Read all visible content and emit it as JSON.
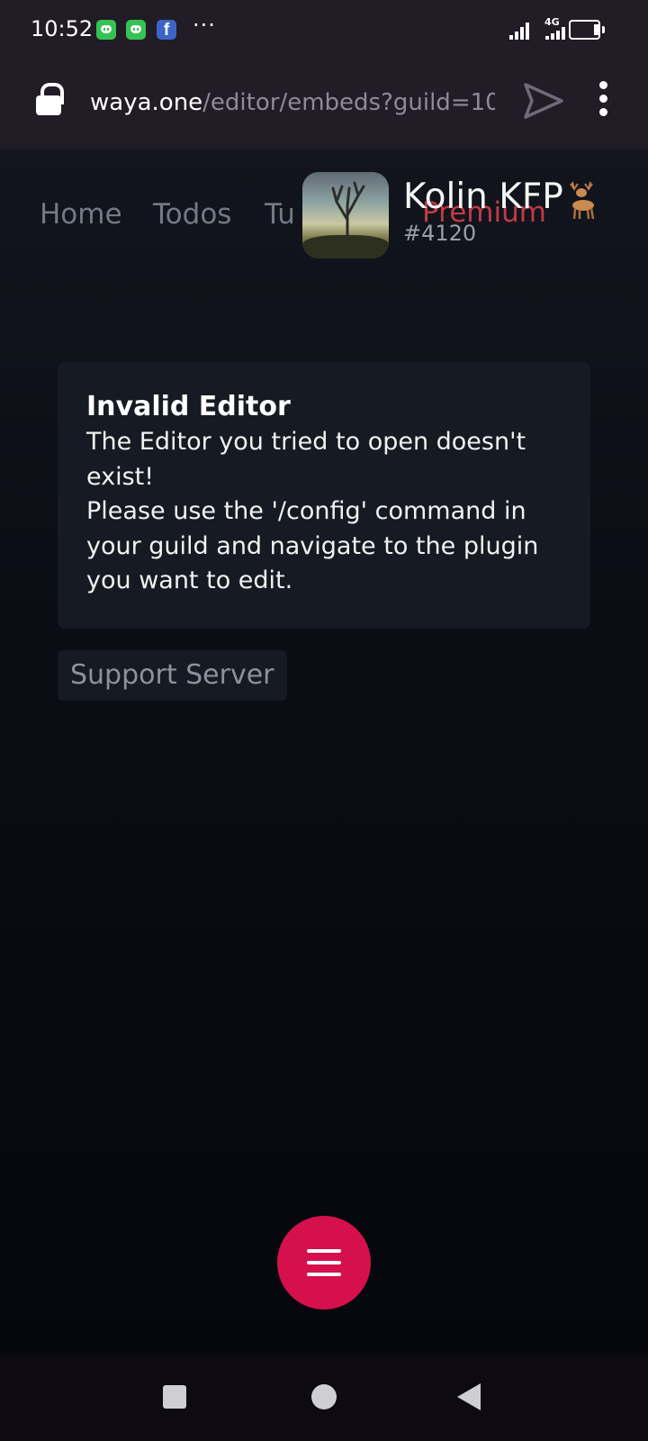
{
  "status_bar": {
    "time": "10:52",
    "network": "4G",
    "notification_icons": [
      "discord-icon",
      "discord-icon",
      "facebook-icon"
    ],
    "more": "···"
  },
  "browser": {
    "url_domain": "waya.one",
    "url_path": "/editor/embeds?guild=10",
    "facebook_glyph": "f"
  },
  "nav": {
    "home": "Home",
    "todos": "Todos",
    "tutorials": "Tu",
    "premium": "Premium"
  },
  "user": {
    "name": "Kolin KFP",
    "tag": "#4120"
  },
  "error": {
    "title": "Invalid Editor",
    "message": "The Editor you tried to open doesn't\nexist!\nPlease use the '/config' command in\nyour guild and navigate to the plugin\nyou want to edit."
  },
  "support_button": "Support Server",
  "colors": {
    "accent": "#d6104c",
    "premium": "#c23a44",
    "card_bg": "#161a22"
  }
}
